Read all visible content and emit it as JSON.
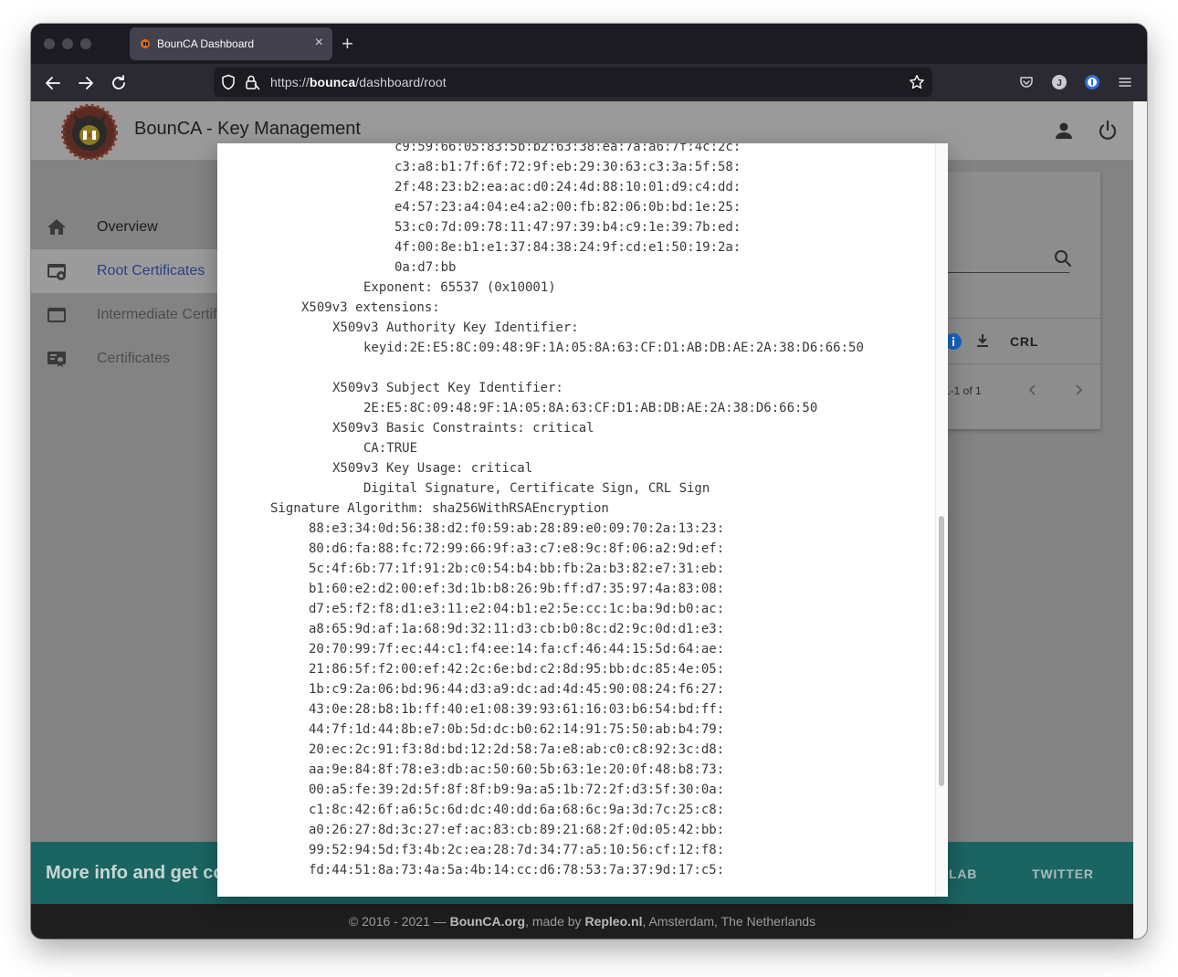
{
  "browser": {
    "tab_title": "BounCA Dashboard",
    "tab_close": "×",
    "new_tab": "+",
    "url_prefix": "https://",
    "url_host": "bounca",
    "url_path": "/dashboard/root"
  },
  "app": {
    "title": "BounCA - Key Management"
  },
  "sidebar": {
    "items": [
      {
        "label": "Overview",
        "icon": "home-icon",
        "state": "normal"
      },
      {
        "label": "Root Certificates",
        "icon": "root-certificate-icon",
        "state": "active"
      },
      {
        "label": "Intermediate Certificates",
        "icon": "intermediate-certificate-icon",
        "state": "muted"
      },
      {
        "label": "Certificates",
        "icon": "certificate-icon",
        "state": "muted"
      }
    ]
  },
  "footer": {
    "headline": "More info and get co",
    "link_gitlab": "LAB",
    "link_twitter": "TWITTER",
    "copyright_pre": "© 2016 - 2021 — ",
    "copyright_site": "BounCA.org",
    "copyright_mid": ", made by ",
    "copyright_author": "Repleo.nl",
    "copyright_post": ", Amsterdam, The Netherlands"
  },
  "modal": {
    "lines": [
      {
        "indent": 194,
        "text": "c9:59:66:05:83:5b:b2:63:38:ea:7a:a6:7f:4c:2c:"
      },
      {
        "indent": 194,
        "text": "c3:a8:b1:7f:6f:72:9f:eb:29:30:63:c3:3a:5f:58:"
      },
      {
        "indent": 194,
        "text": "2f:48:23:b2:ea:ac:d0:24:4d:88:10:01:d9:c4:dd:"
      },
      {
        "indent": 194,
        "text": "e4:57:23:a4:04:e4:a2:00:fb:82:06:0b:bd:1e:25:"
      },
      {
        "indent": 194,
        "text": "53:c0:7d:09:78:11:47:97:39:b4:c9:1e:39:7b:ed:"
      },
      {
        "indent": 194,
        "text": "4f:00:8e:b1:e1:37:84:38:24:9f:cd:e1:50:19:2a:"
      },
      {
        "indent": 194,
        "text": "0a:d7:bb"
      },
      {
        "indent": 160,
        "text": "Exponent: 65537 (0x10001)"
      },
      {
        "indent": 92,
        "text": "X509v3 extensions:"
      },
      {
        "indent": 126,
        "text": "X509v3 Authority Key Identifier:"
      },
      {
        "indent": 160,
        "text": "keyid:2E:E5:8C:09:48:9F:1A:05:8A:63:CF:D1:AB:DB:AE:2A:38:D6:66:50"
      },
      {
        "indent": 160,
        "text": ""
      },
      {
        "indent": 126,
        "text": "X509v3 Subject Key Identifier:"
      },
      {
        "indent": 160,
        "text": "2E:E5:8C:09:48:9F:1A:05:8A:63:CF:D1:AB:DB:AE:2A:38:D6:66:50"
      },
      {
        "indent": 126,
        "text": "X509v3 Basic Constraints: critical"
      },
      {
        "indent": 160,
        "text": "CA:TRUE"
      },
      {
        "indent": 126,
        "text": "X509v3 Key Usage: critical"
      },
      {
        "indent": 160,
        "text": "Digital Signature, Certificate Sign, CRL Sign"
      },
      {
        "indent": 58,
        "text": "Signature Algorithm: sha256WithRSAEncryption"
      },
      {
        "indent": 100,
        "text": "88:e3:34:0d:56:38:d2:f0:59:ab:28:89:e0:09:70:2a:13:23:"
      },
      {
        "indent": 100,
        "text": "80:d6:fa:88:fc:72:99:66:9f:a3:c7:e8:9c:8f:06:a2:9d:ef:"
      },
      {
        "indent": 100,
        "text": "5c:4f:6b:77:1f:91:2b:c0:54:b4:bb:fb:2a:b3:82:e7:31:eb:"
      },
      {
        "indent": 100,
        "text": "b1:60:e2:d2:00:ef:3d:1b:b8:26:9b:ff:d7:35:97:4a:83:08:"
      },
      {
        "indent": 100,
        "text": "d7:e5:f2:f8:d1:e3:11:e2:04:b1:e2:5e:cc:1c:ba:9d:b0:ac:"
      },
      {
        "indent": 100,
        "text": "a8:65:9d:af:1a:68:9d:32:11:d3:cb:b0:8c:d2:9c:0d:d1:e3:"
      },
      {
        "indent": 100,
        "text": "20:70:99:7f:ec:44:c1:f4:ee:14:fa:cf:46:44:15:5d:64:ae:"
      },
      {
        "indent": 100,
        "text": "21:86:5f:f2:00:ef:42:2c:6e:bd:c2:8d:95:bb:dc:85:4e:05:"
      },
      {
        "indent": 100,
        "text": "1b:c9:2a:06:bd:96:44:d3:a9:dc:ad:4d:45:90:08:24:f6:27:"
      },
      {
        "indent": 100,
        "text": "43:0e:28:b8:1b:ff:40:e1:08:39:93:61:16:03:b6:54:bd:ff:"
      },
      {
        "indent": 100,
        "text": "44:7f:1d:44:8b:e7:0b:5d:dc:b0:62:14:91:75:50:ab:b4:79:"
      },
      {
        "indent": 100,
        "text": "20:ec:2c:91:f3:8d:bd:12:2d:58:7a:e8:ab:c0:c8:92:3c:d8:"
      },
      {
        "indent": 100,
        "text": "aa:9e:84:8f:78:e3:db:ac:50:60:5b:63:1e:20:0f:48:b8:73:"
      },
      {
        "indent": 100,
        "text": "00:a5:fe:39:2d:5f:8f:8f:b9:9a:a5:1b:72:2f:d3:5f:30:0a:"
      },
      {
        "indent": 100,
        "text": "c1:8c:42:6f:a6:5c:6d:dc:40:dd:6a:68:6c:9a:3d:7c:25:c8:"
      },
      {
        "indent": 100,
        "text": "a0:26:27:8d:3c:27:ef:ac:83:cb:89:21:68:2f:0d:05:42:bb:"
      },
      {
        "indent": 100,
        "text": "99:52:94:5d:f3:4b:2c:ea:28:7d:34:77:a5:10:56:cf:12:f8:"
      },
      {
        "indent": 100,
        "text": "fd:44:51:8a:73:4a:5a:4b:14:cc:d6:78:53:7a:37:9d:17:c5:"
      }
    ]
  },
  "colors": {
    "accent_active": "#2a4180",
    "footer_band": "#1a6562",
    "info_icon": "#1565c0"
  }
}
